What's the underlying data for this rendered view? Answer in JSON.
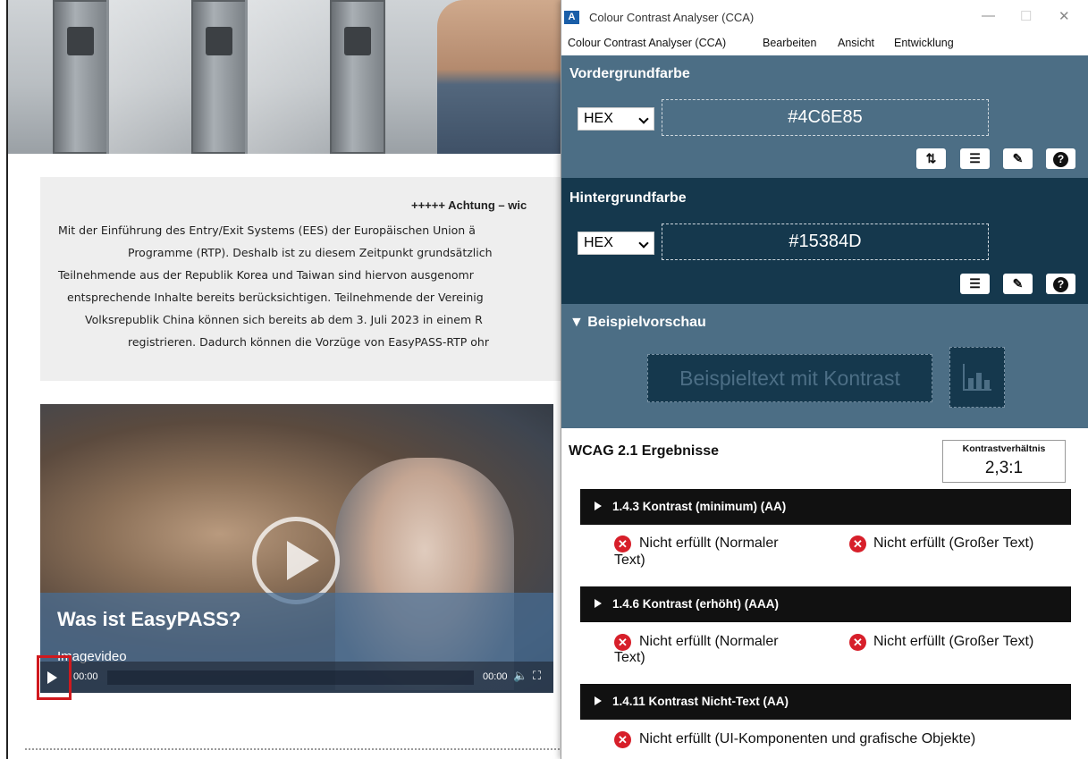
{
  "webpage": {
    "notice_title": "+++++ Achtung – wic",
    "notice_lines": [
      "Mit der Einführung des Entry/Exit Systems (EES) der Europäischen Union ä",
      "Programme (RTP). Deshalb ist zu diesem Zeitpunkt grundsätzlich",
      "Teilnehmende aus der Republik Korea und Taiwan sind hiervon ausgenomr",
      "entsprechende Inhalte bereits berücksichtigen. Teilnehmende der Vereinig",
      "Volksrepublik China können sich bereits ab dem 3. Juli 2023 in einem R",
      "registrieren. Dadurch können die Vorzüge von EasyPASS-RTP ohr"
    ],
    "video": {
      "title": "Was ist EasyPASS?",
      "subtitle": "Imagevideo",
      "time_current": "00:00",
      "time_total": "00:00"
    }
  },
  "cca": {
    "window_title": "Colour Contrast Analyser (CCA)",
    "menu": [
      "Colour Contrast Analyser (CCA)",
      "Bearbeiten",
      "Ansicht",
      "Entwicklung"
    ],
    "foreground": {
      "heading": "Vordergrundfarbe",
      "format": "HEX",
      "value": "#4C6E85",
      "color": "#4c6e85"
    },
    "background": {
      "heading": "Hintergrundfarbe",
      "format": "HEX",
      "value": "#15384D",
      "color": "#15384d"
    },
    "preview": {
      "heading": "Beispielvorschau",
      "sample_text": "Beispieltext mit Kontrast"
    },
    "results": {
      "heading": "WCAG 2.1 Ergebnisse",
      "ratio_label": "Kontrastverhältnis",
      "ratio_value": "2,3:1",
      "criteria": [
        {
          "title": "1.4.3 Kontrast (minimum) (AA)",
          "normal": "Nicht erfüllt (Normaler",
          "normal_cont": "Text)",
          "large": "Nicht erfüllt (Großer Text)"
        },
        {
          "title": "1.4.6 Kontrast (erhöht) (AAA)",
          "normal": "Nicht erfüllt (Normaler",
          "normal_cont": "Text)",
          "large": "Nicht erfüllt (Großer Text)"
        },
        {
          "title": "1.4.11 Kontrast Nicht-Text (AA)",
          "ui": "Nicht erfüllt (UI-Komponenten und grafische Objekte)"
        }
      ]
    }
  }
}
